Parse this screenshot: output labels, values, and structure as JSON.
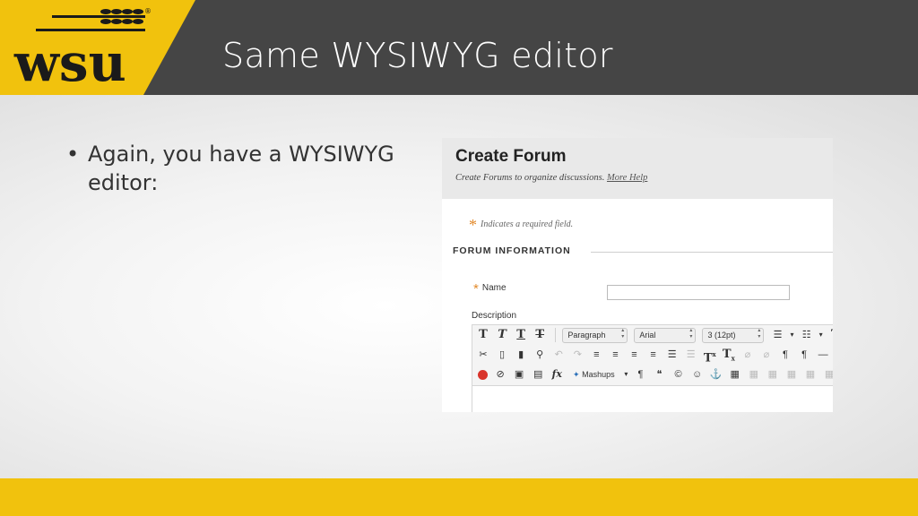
{
  "slide": {
    "title": "Same WYSIWYG editor",
    "bullet_marker": "•",
    "bullet_text": "Again, you have a WYSIWYG editor:"
  },
  "logo": {
    "text": "wsu",
    "registered": "®"
  },
  "colors": {
    "header": "#454545",
    "accent_yellow": "#f1c20d",
    "required_star": "#e28a2b"
  },
  "screenshot": {
    "title": "Create Forum",
    "subtitle": "Create Forums to organize discussions.",
    "help_link": "More Help",
    "required_star": "*",
    "required_note": "Indicates a required field.",
    "section_title": "FORUM INFORMATION",
    "name_label": "Name",
    "description_label": "Description",
    "toolbar": {
      "row1": {
        "text_buttons": [
          "T",
          "T",
          "T",
          "T"
        ],
        "paragraph_select": "Paragraph",
        "font_select": "Arial",
        "size_select": "3 (12pt)",
        "list_buttons": [
          "☰",
          "▾",
          "☷",
          "▾",
          "T",
          "▾"
        ]
      },
      "row2": {
        "buttons": [
          "✂",
          "▯",
          "▮",
          "⚲",
          "↶",
          "↷",
          "≡",
          "≡",
          "≡",
          "≡",
          "☰",
          "☰",
          "T",
          "T",
          "⌀",
          "⌀",
          "¶",
          "¶",
          "—",
          "━"
        ],
        "superscript": "x",
        "subscript": "x"
      },
      "row3": {
        "mashups_label": "Mashups",
        "buttons": [
          "▣",
          "▤",
          "fx",
          "¶",
          "❝",
          "©",
          "☺",
          "⚓",
          "▦"
        ]
      }
    }
  }
}
